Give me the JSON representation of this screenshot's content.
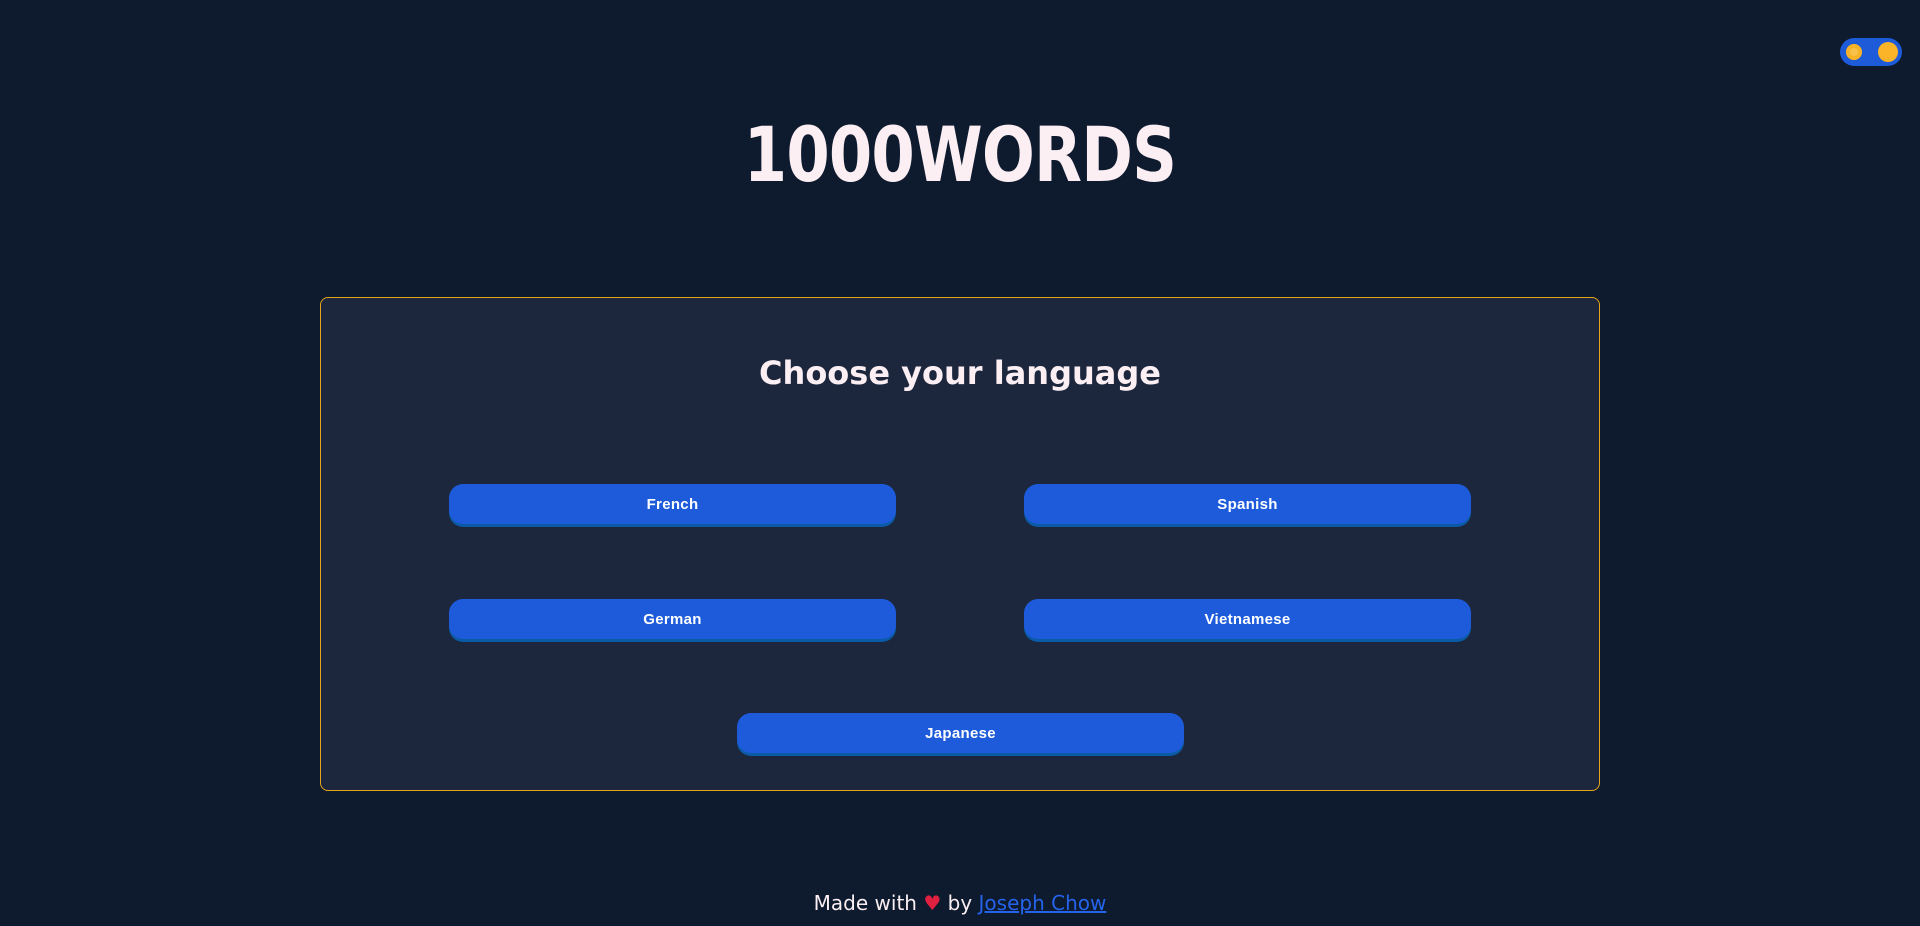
{
  "header": {
    "title": "1000WORDS",
    "theme_toggle": {
      "icons": [
        "sun-icon",
        "toggle-knob"
      ],
      "colors": {
        "track": "#1d5bd8",
        "knob": "#fbb427"
      }
    }
  },
  "main": {
    "heading": "Choose your language",
    "languages": [
      "French",
      "Spanish",
      "German",
      "Vietnamese",
      "Japanese"
    ]
  },
  "footer": {
    "prefix": "Made with",
    "heart": "♥",
    "by": "by",
    "author": "Joseph Chow"
  },
  "colors": {
    "background": "#0e1a2d",
    "card": "#1c263c",
    "card_border": "#e5a51b",
    "button": "#1d5bdb",
    "link": "#2563eb",
    "heart": "#e0203f"
  }
}
